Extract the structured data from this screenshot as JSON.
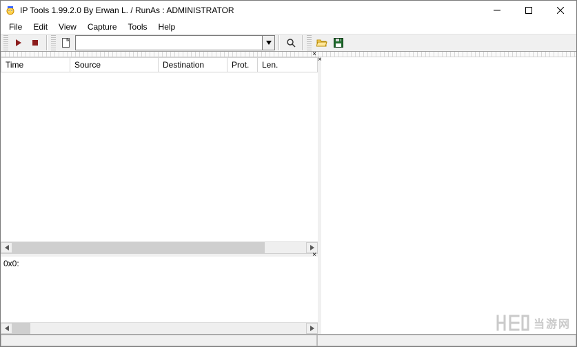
{
  "window": {
    "title": "IP Tools 1.99.2.0 By Erwan L. / RunAs : ADMINISTRATOR"
  },
  "menu": {
    "items": [
      "File",
      "Edit",
      "View",
      "Capture",
      "Tools",
      "Help"
    ]
  },
  "toolbar": {
    "start_tip": "start",
    "stop_tip": "stop",
    "new_tip": "new",
    "filter_value": "",
    "search_tip": "search",
    "open_tip": "open",
    "save_tip": "save"
  },
  "columns": {
    "time": "Time",
    "source": "Source",
    "destination": "Destination",
    "protocol": "Prot.",
    "length": "Len."
  },
  "hex": {
    "label": "0x0:"
  },
  "watermark": {
    "text": "当游网"
  }
}
